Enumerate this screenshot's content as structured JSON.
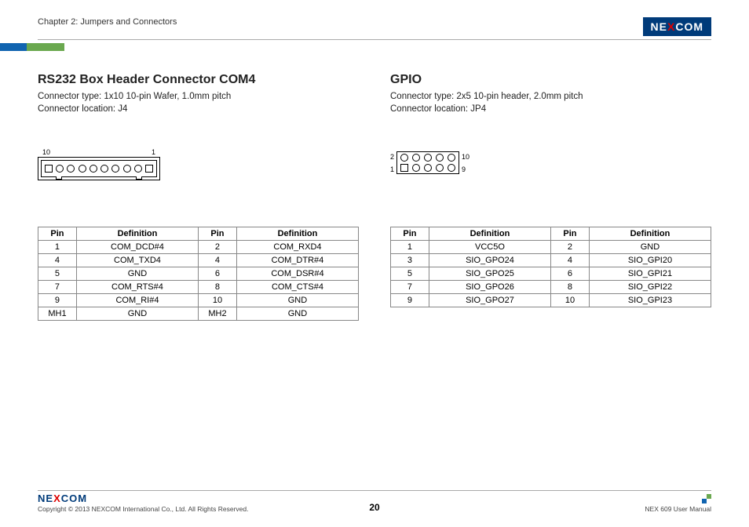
{
  "header": {
    "chapter": "Chapter 2: Jumpers and Connectors",
    "brand_pre": "NE",
    "brand_x": "X",
    "brand_post": "COM"
  },
  "left": {
    "title": "RS232 Box Header Connector COM4",
    "type_line": "Connector type: 1x10 10-pin Wafer, 1.0mm pitch",
    "loc_line": "Connector location: J4",
    "diagram": {
      "label_left": "10",
      "label_right": "1"
    },
    "headers": {
      "pin": "Pin",
      "def": "Definition"
    },
    "rows": [
      {
        "p1": "1",
        "d1": "COM_DCD#4",
        "p2": "2",
        "d2": "COM_RXD4"
      },
      {
        "p1": "4",
        "d1": "COM_TXD4",
        "p2": "4",
        "d2": "COM_DTR#4"
      },
      {
        "p1": "5",
        "d1": "GND",
        "p2": "6",
        "d2": "COM_DSR#4"
      },
      {
        "p1": "7",
        "d1": "COM_RTS#4",
        "p2": "8",
        "d2": "COM_CTS#4"
      },
      {
        "p1": "9",
        "d1": "COM_RI#4",
        "p2": "10",
        "d2": "GND"
      },
      {
        "p1": "MH1",
        "d1": "GND",
        "p2": "MH2",
        "d2": "GND"
      }
    ]
  },
  "right": {
    "title": "GPIO",
    "type_line": "Connector type: 2x5 10-pin header, 2.0mm pitch",
    "loc_line": "Connector location: JP4",
    "diagram": {
      "tl": "2",
      "bl": "1",
      "tr": "10",
      "br": "9"
    },
    "headers": {
      "pin": "Pin",
      "def": "Definition"
    },
    "rows": [
      {
        "p1": "1",
        "d1": "VCC5O",
        "p2": "2",
        "d2": "GND"
      },
      {
        "p1": "3",
        "d1": "SIO_GPO24",
        "p2": "4",
        "d2": "SIO_GPI20"
      },
      {
        "p1": "5",
        "d1": "SIO_GPO25",
        "p2": "6",
        "d2": "SIO_GPI21"
      },
      {
        "p1": "7",
        "d1": "SIO_GPO26",
        "p2": "8",
        "d2": "SIO_GPI22"
      },
      {
        "p1": "9",
        "d1": "SIO_GPO27",
        "p2": "10",
        "d2": "SIO_GPI23"
      }
    ]
  },
  "footer": {
    "brand_pre": "NE",
    "brand_x": "X",
    "brand_post": "COM",
    "copyright": "Copyright © 2013 NEXCOM International Co., Ltd. All Rights Reserved.",
    "page": "20",
    "manual": "NEX 609 User Manual"
  }
}
